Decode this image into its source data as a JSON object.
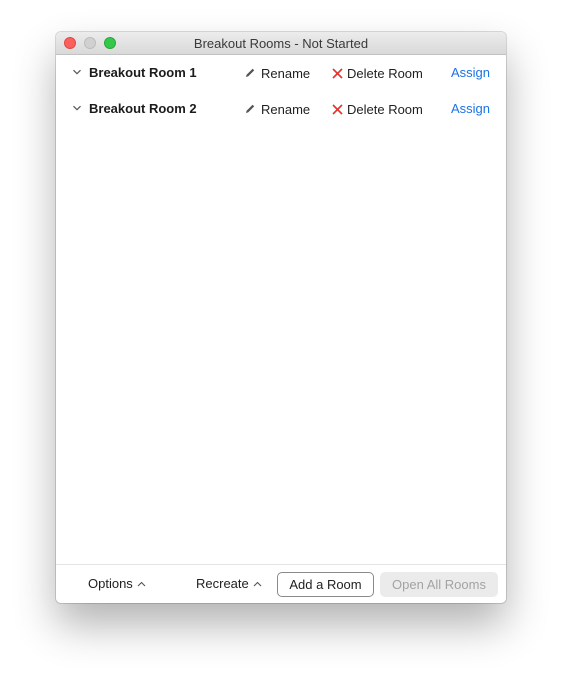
{
  "window": {
    "title": "Breakout Rooms - Not Started"
  },
  "rooms": [
    {
      "name": "Breakout Room 1",
      "rename_label": "Rename",
      "delete_label": "Delete Room",
      "assign_label": "Assign"
    },
    {
      "name": "Breakout Room 2",
      "rename_label": "Rename",
      "delete_label": "Delete Room",
      "assign_label": "Assign"
    }
  ],
  "footer": {
    "options_label": "Options",
    "recreate_label": "Recreate",
    "add_room_label": "Add a Room",
    "open_all_label": "Open All Rooms"
  },
  "icons": {
    "expand": "chevron-down-icon",
    "rename": "pencil-icon",
    "delete": "x-icon",
    "menu": "caret-up-icon"
  },
  "colors": {
    "link": "#1a73e8",
    "delete_x": "#e5322d",
    "close_dot": "#fc605c",
    "minimize_dot": "#d1d1d1",
    "maximize_dot": "#34c84a",
    "disabled_text": "#a3a3a3"
  }
}
